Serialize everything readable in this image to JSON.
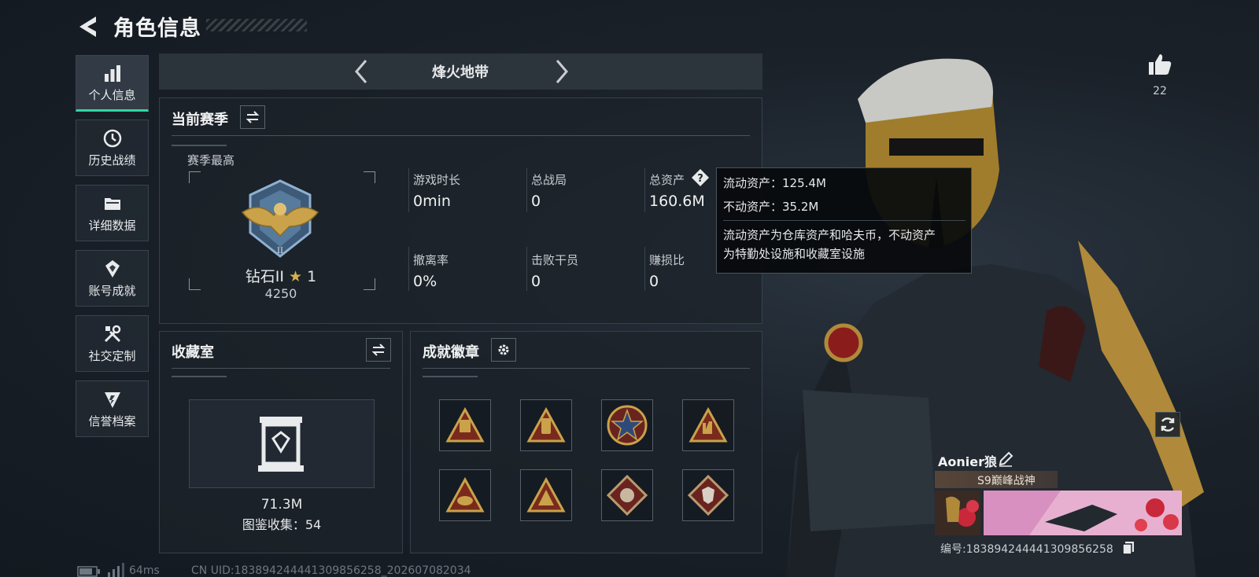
{
  "header": {
    "title": "角色信息"
  },
  "nav": {
    "items": [
      {
        "label": "个人信息",
        "icon": "bar-chart-icon",
        "active": true
      },
      {
        "label": "历史战绩",
        "icon": "history-icon"
      },
      {
        "label": "详细数据",
        "icon": "folder-icon"
      },
      {
        "label": "账号成就",
        "icon": "achievement-icon"
      },
      {
        "label": "社交定制",
        "icon": "tools-icon"
      },
      {
        "label": "信誉档案",
        "icon": "credit-icon"
      }
    ]
  },
  "mode": {
    "title": "烽火地带"
  },
  "season": {
    "title": "当前赛季",
    "best_label": "赛季最高",
    "rank_name": "钻石II",
    "rank_star_count": "1",
    "rank_score": "4250",
    "stats": [
      {
        "label": "游戏时长",
        "value": "0min"
      },
      {
        "label": "总战局",
        "value": "0"
      },
      {
        "label": "总资产",
        "value": "160.6M"
      },
      {
        "label": "撤离率",
        "value": "0%"
      },
      {
        "label": "击败干员",
        "value": "0"
      },
      {
        "label": "赚损比",
        "value": "0"
      }
    ]
  },
  "tooltip": {
    "liquid": "流动资产：125.4M",
    "fixed": "不动资产：35.2M",
    "desc_line1": "流动资产为仓库资产和哈夫币，不动资产",
    "desc_line2": "为特勤处设施和收藏室设施"
  },
  "collection": {
    "title": "收藏室",
    "value": "71.3M",
    "index_label": "图鉴收集：54"
  },
  "achievements": {
    "title": "成就徽章"
  },
  "profile": {
    "likes": "22",
    "name": "Aonier狼",
    "tag": "S9巅峰战神",
    "id_label": "编号:1838942444413098562​58"
  },
  "status": {
    "ping": "64ms",
    "uid": "CN UID:1838942444413098562​58_202607082034"
  },
  "colors": {
    "accent": "#2fd6a3",
    "gold": "#c9a24a",
    "panel": "#1c232a"
  }
}
